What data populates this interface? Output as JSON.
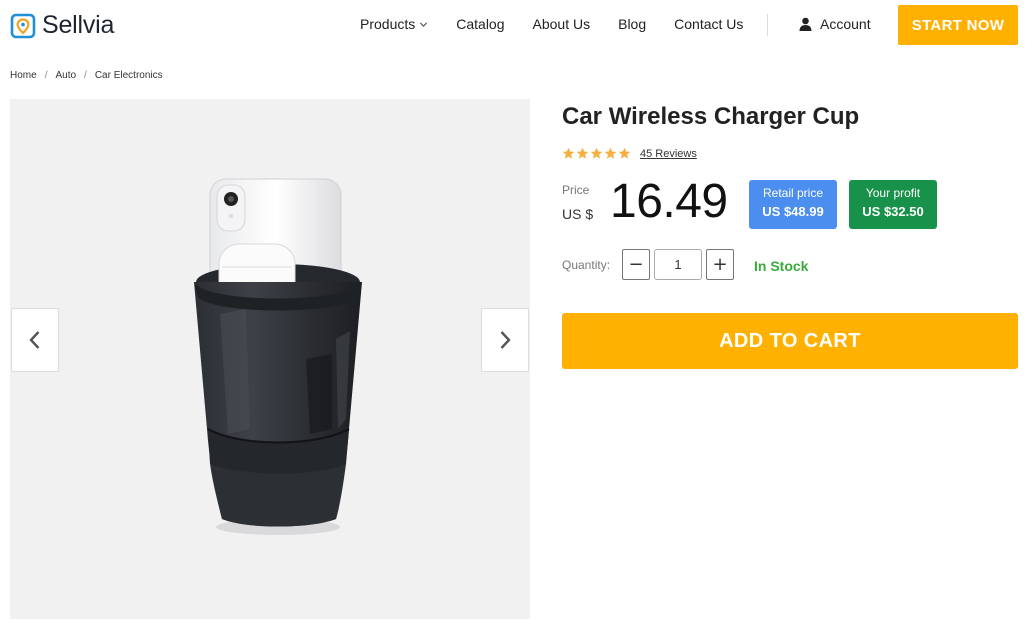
{
  "brand": {
    "name": "Sellvia",
    "logo_color": "#1f8fd8",
    "icon": "map-pin-logo"
  },
  "nav": {
    "items": [
      {
        "label": "Products",
        "has_dropdown": true
      },
      {
        "label": "Catalog"
      },
      {
        "label": "About Us"
      },
      {
        "label": "Blog"
      },
      {
        "label": "Contact Us"
      }
    ],
    "account_label": "Account",
    "account_icon": "user-icon",
    "cta_label": "START NOW",
    "cta_color": "#ffb000"
  },
  "breadcrumb": [
    "Home",
    "Auto",
    "Car Electronics"
  ],
  "breadcrumb_separator": "/",
  "gallery": {
    "prev_icon": "chevron-left-icon",
    "next_icon": "chevron-right-icon"
  },
  "product": {
    "title": "Car Wireless Charger Cup",
    "rating": 5,
    "star_color": "#f5b041",
    "reviews_label": "45 Reviews",
    "price_label": "Price",
    "currency": "US $",
    "price": "16.49",
    "retail_label": "Retail price",
    "retail_value": "US $48.99",
    "retail_color": "#4b8ef0",
    "profit_label": "Your profit",
    "profit_value": "US $32.50",
    "profit_color": "#18924a",
    "quantity_label": "Quantity:",
    "quantity": "1",
    "minus_label": "−",
    "plus_label": "+",
    "stock_label": "In Stock",
    "stock_color": "#3aaa3a",
    "add_to_cart_label": "ADD TO CART"
  }
}
